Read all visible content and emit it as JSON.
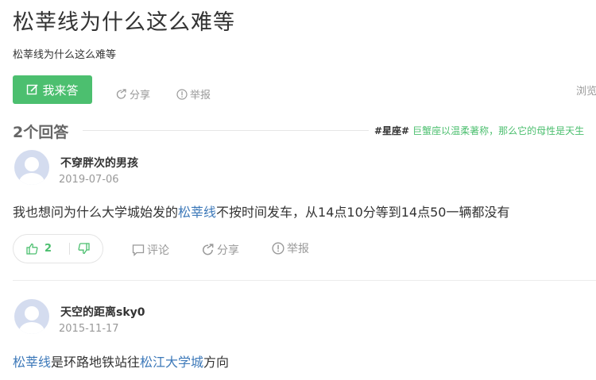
{
  "question": {
    "title": "松莘线为什么这么难等",
    "description": "松莘线为什么这么难等",
    "answer_button_label": "我来答",
    "share_label": "分享",
    "report_label": "举报",
    "browse_label": "浏览"
  },
  "answers_header": {
    "count_label": "2个回答",
    "tag_name": "#星座#",
    "tag_text": "巨蟹座以温柔著称，那么它的母性是天生"
  },
  "answers": [
    {
      "user": "不穿胖次的男孩",
      "date": "2019-07-06",
      "content": {
        "before": "我也想问为什么大学城始发的",
        "link1": "松莘线",
        "after": "不按时间发车，从14点10分等到14点50一辆都没有"
      },
      "upvotes": "2",
      "comment_label": "评论",
      "share_label": "分享",
      "report_label": "举报"
    },
    {
      "user": "天空的距离sky0",
      "date": "2015-11-17",
      "content": {
        "link1": "松莘线",
        "middle": "是环路地铁站往",
        "link2": "松江大学城",
        "after": "方向"
      }
    }
  ],
  "colors": {
    "accent_green": "#4cbf6f",
    "link_blue": "#3d79b9",
    "muted_gray": "#999999"
  }
}
